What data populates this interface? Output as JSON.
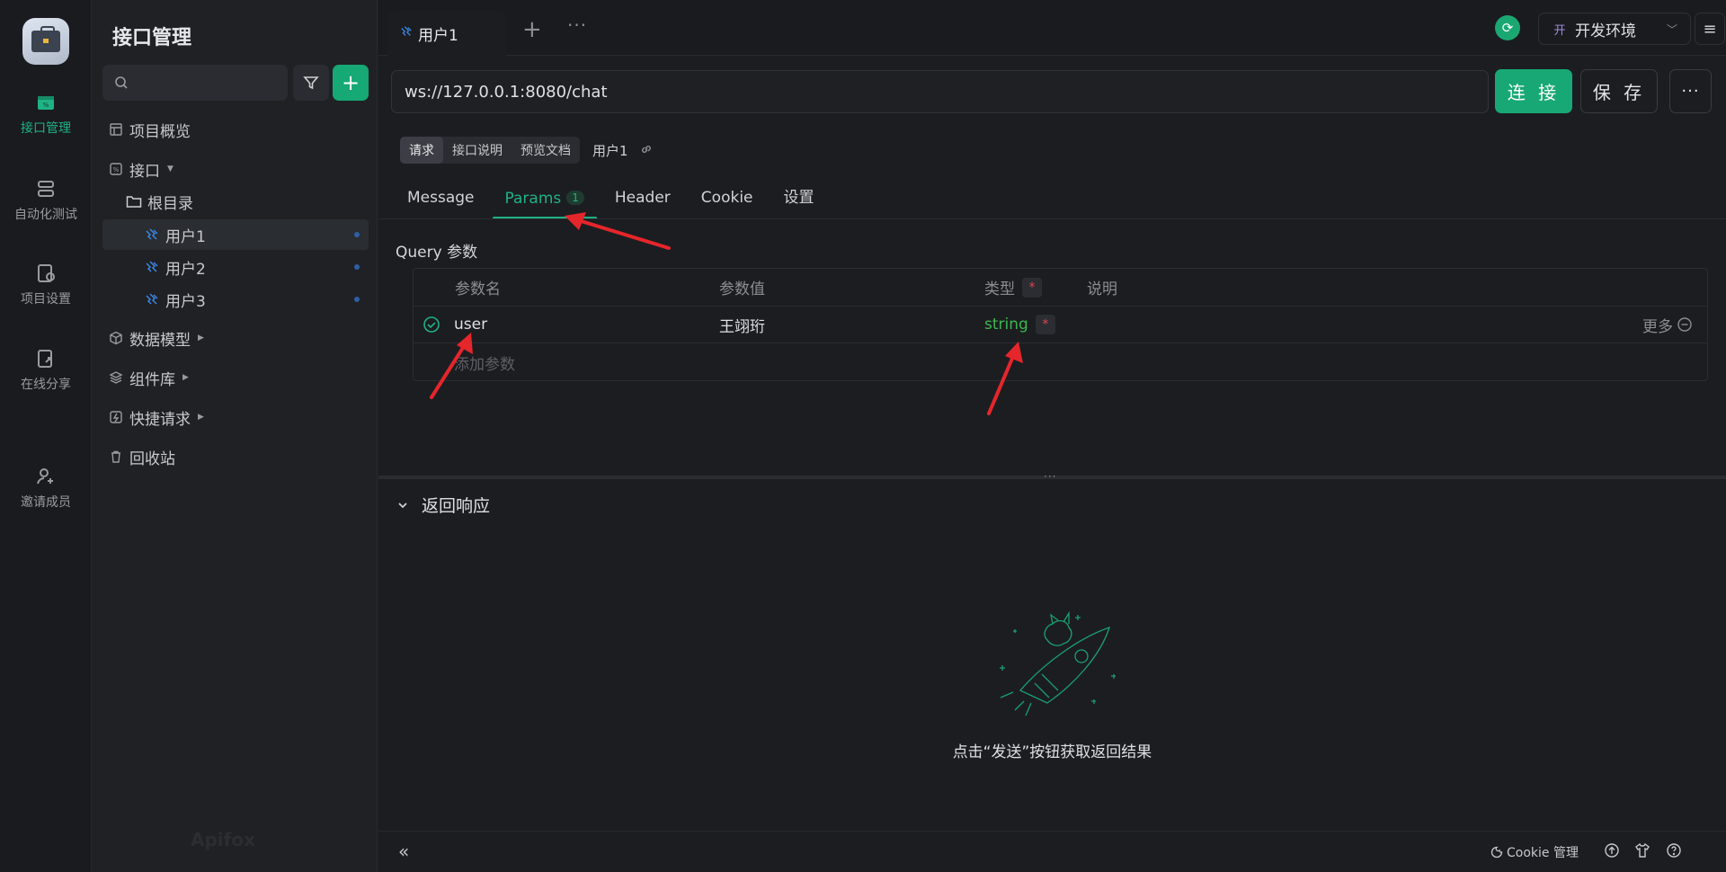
{
  "rail": {
    "items": [
      {
        "label": "接口管理",
        "icon": "api-management-icon",
        "active": true
      },
      {
        "label": "自动化测试",
        "icon": "automation-test-icon"
      },
      {
        "label": "项目设置",
        "icon": "project-settings-icon"
      },
      {
        "label": "在线分享",
        "icon": "online-share-icon"
      },
      {
        "label": "邀请成员",
        "icon": "invite-member-icon"
      }
    ]
  },
  "sidebar": {
    "title": "接口管理",
    "search_placeholder": "",
    "tree": [
      {
        "label": "项目概览",
        "icon": "overview-icon"
      },
      {
        "label": "接口",
        "icon": "api-icon"
      },
      {
        "label": "根目录",
        "icon": "folder-icon"
      },
      {
        "label": "用户1",
        "icon": "websocket-icon",
        "selected": true
      },
      {
        "label": "用户2",
        "icon": "websocket-icon"
      },
      {
        "label": "用户3",
        "icon": "websocket-icon"
      },
      {
        "label": "数据模型",
        "icon": "data-model-icon"
      },
      {
        "label": "组件库",
        "icon": "component-library-icon"
      },
      {
        "label": "快捷请求",
        "icon": "quick-request-icon"
      },
      {
        "label": "回收站",
        "icon": "trash-icon"
      }
    ],
    "watermark": "Apifox"
  },
  "tabbar": {
    "active_tab": "用户1",
    "environment_badge": "开",
    "environment": "开发环境"
  },
  "request": {
    "url": "ws://127.0.0.1:8080/chat",
    "connect_label": "连 接",
    "save_label": "保 存",
    "subtabs": [
      "请求",
      "接口说明",
      "预览文档"
    ],
    "api_name": "用户1",
    "tabs": [
      {
        "label": "Message"
      },
      {
        "label": "Params",
        "count": "1",
        "active": true
      },
      {
        "label": "Header"
      },
      {
        "label": "Cookie"
      },
      {
        "label": "设置"
      }
    ],
    "query_title": "Query 参数",
    "columns": {
      "name": "参数名",
      "value": "参数值",
      "type": "类型",
      "required_mark": "*",
      "desc": "说明"
    },
    "params": [
      {
        "name": "user",
        "value": "王翊珩",
        "type": "string",
        "required_mark": "*",
        "more": "更多"
      }
    ],
    "add_param": "添加参数"
  },
  "response": {
    "title": "返回响应",
    "hint": "点击“发送”按钮获取返回结果"
  },
  "footer": {
    "cookie_label": "Cookie 管理"
  },
  "colors": {
    "accent": "#17a876",
    "annotation_arrow": "#e5262b",
    "type_string": "#3cb84e",
    "required": "#e0434f"
  }
}
